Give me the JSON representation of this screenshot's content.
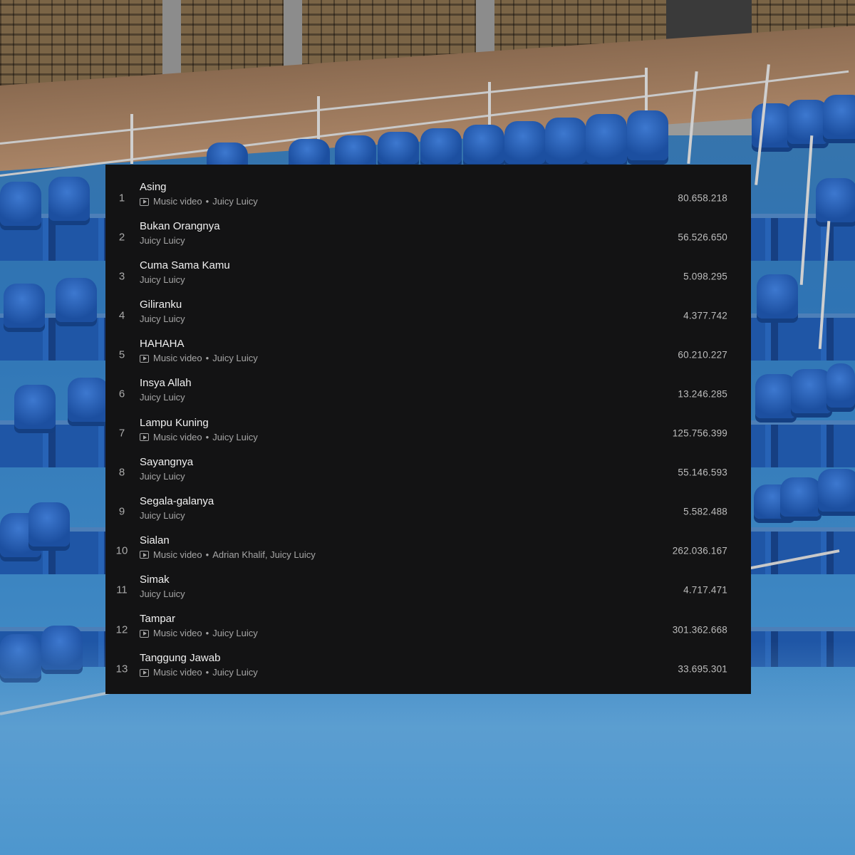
{
  "tracks": [
    {
      "rank": "1",
      "title": "Asing",
      "music_video": true,
      "music_video_label": "Music video",
      "artist": "Juicy Luicy",
      "plays": "80.658.218"
    },
    {
      "rank": "2",
      "title": "Bukan Orangnya",
      "music_video": false,
      "artist": "Juicy Luicy",
      "plays": "56.526.650"
    },
    {
      "rank": "3",
      "title": "Cuma Sama Kamu",
      "music_video": false,
      "artist": "Juicy Luicy",
      "plays": "5.098.295"
    },
    {
      "rank": "4",
      "title": "Giliranku",
      "music_video": false,
      "artist": "Juicy Luicy",
      "plays": "4.377.742"
    },
    {
      "rank": "5",
      "title": "HAHAHA",
      "music_video": true,
      "music_video_label": "Music video",
      "artist": "Juicy Luicy",
      "plays": "60.210.227"
    },
    {
      "rank": "6",
      "title": "Insya Allah",
      "music_video": false,
      "artist": "Juicy Luicy",
      "plays": "13.246.285"
    },
    {
      "rank": "7",
      "title": "Lampu Kuning",
      "music_video": true,
      "music_video_label": "Music video",
      "artist": "Juicy Luicy",
      "plays": "125.756.399"
    },
    {
      "rank": "8",
      "title": "Sayangnya",
      "music_video": false,
      "artist": "Juicy Luicy",
      "plays": "55.146.593"
    },
    {
      "rank": "9",
      "title": "Segala-galanya",
      "music_video": false,
      "artist": "Juicy Luicy",
      "plays": "5.582.488"
    },
    {
      "rank": "10",
      "title": "Sialan",
      "music_video": true,
      "music_video_label": "Music video",
      "artist": "Adrian Khalif, Juicy Luicy",
      "plays": "262.036.167"
    },
    {
      "rank": "11",
      "title": "Simak",
      "music_video": false,
      "artist": "Juicy Luicy",
      "plays": "4.717.471"
    },
    {
      "rank": "12",
      "title": "Tampar",
      "music_video": true,
      "music_video_label": "Music video",
      "artist": "Juicy Luicy",
      "plays": "301.362.668"
    },
    {
      "rank": "13",
      "title": "Tanggung Jawab",
      "music_video": true,
      "music_video_label": "Music video",
      "artist": "Juicy Luicy",
      "plays": "33.695.301"
    }
  ],
  "separator": "•",
  "icons": {
    "music_video": "music-video-icon"
  },
  "colors": {
    "panel_bg": "#131314",
    "title_text": "#f1f1f1",
    "sub_text": "#a6a6a6",
    "seat_blue": "#1f56a6"
  }
}
